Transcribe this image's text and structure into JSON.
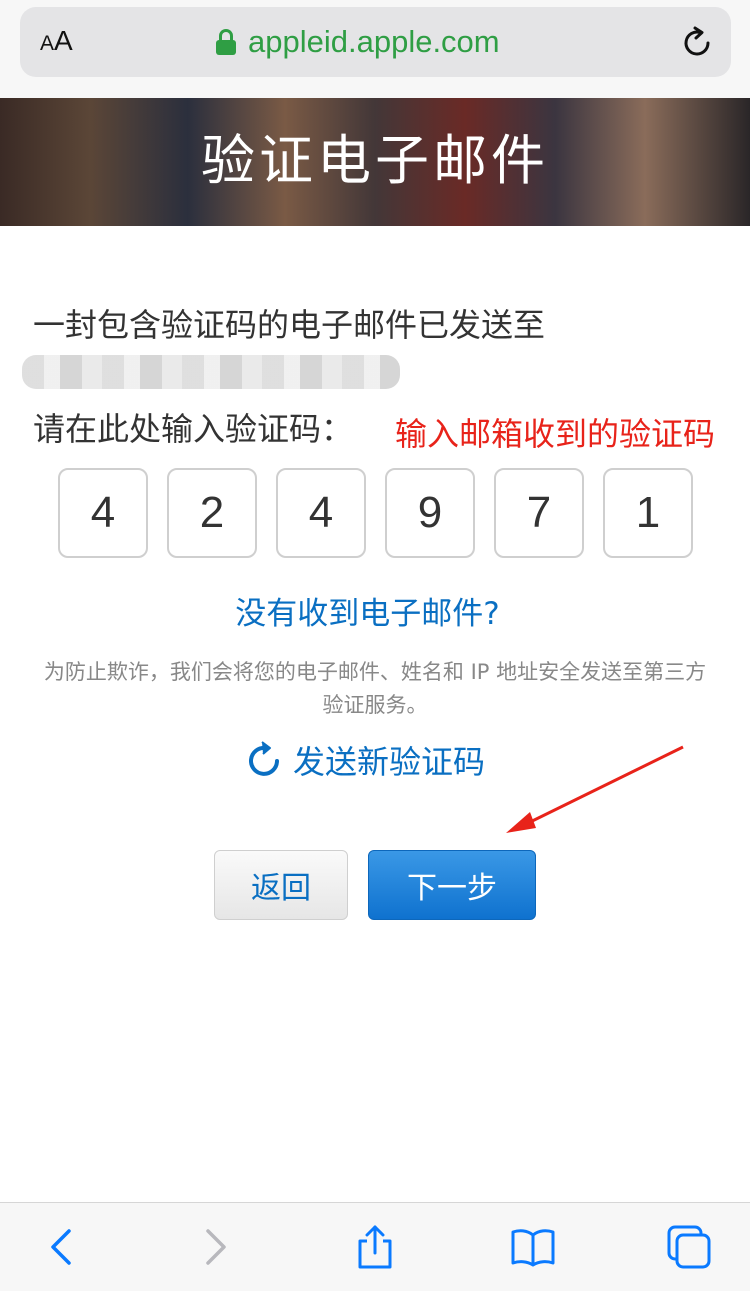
{
  "browser": {
    "text_size_label": "AA",
    "url": "appleid.apple.com"
  },
  "header": {
    "title": "验证电子邮件"
  },
  "main": {
    "sent_text": "一封包含验证码的电子邮件已发送至",
    "prompt": "请在此处输入验证码：",
    "annotation": "输入邮箱收到的验证码",
    "code_digits": [
      "4",
      "2",
      "4",
      "9",
      "7",
      "1"
    ],
    "no_email_link": "没有收到电子邮件?",
    "fraud_note": "为防止欺诈，我们会将您的电子邮件、姓名和 IP 地址安全发送至第三方验证服务。",
    "resend_label": "发送新验证码"
  },
  "buttons": {
    "back": "返回",
    "next": "下一步"
  },
  "colors": {
    "link_blue": "#0a6fc2",
    "secure_green": "#2f9e44",
    "annotation_red": "#e8231a"
  },
  "icons": [
    "lock-icon",
    "reload-icon",
    "resend-icon",
    "back-arrow-icon",
    "forward-arrow-icon",
    "share-icon",
    "bookmarks-icon",
    "tabs-icon"
  ]
}
